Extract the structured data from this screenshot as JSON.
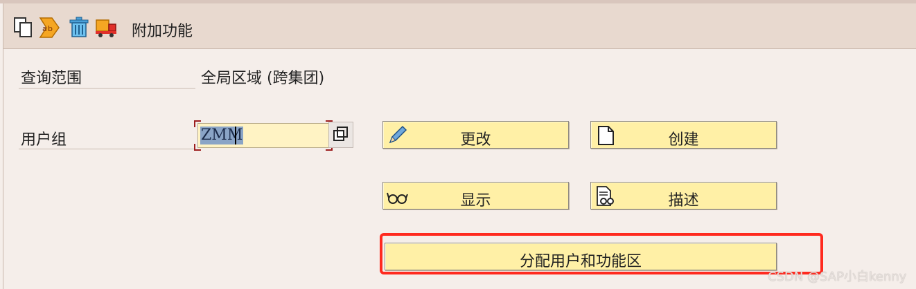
{
  "toolbar": {
    "icons": [
      "copy-icon",
      "rename-icon",
      "delete-icon",
      "transport-icon"
    ],
    "label": "附加功能"
  },
  "query_scope": {
    "label": "查询范围",
    "value": "全局区域 (跨集团)"
  },
  "user_group": {
    "label": "用户组",
    "value": "ZMM"
  },
  "buttons": {
    "change": "更改",
    "create": "创建",
    "display": "显示",
    "describe": "描述",
    "assign": "分配用户和功能区"
  },
  "watermark": "CSDN @SAP小白kenny",
  "colors": {
    "background": "#f5eeea",
    "toolbar": "#e8d9cf",
    "button": "#fff0a6",
    "input": "#fff3c4",
    "highlight": "#ff2a1f"
  }
}
